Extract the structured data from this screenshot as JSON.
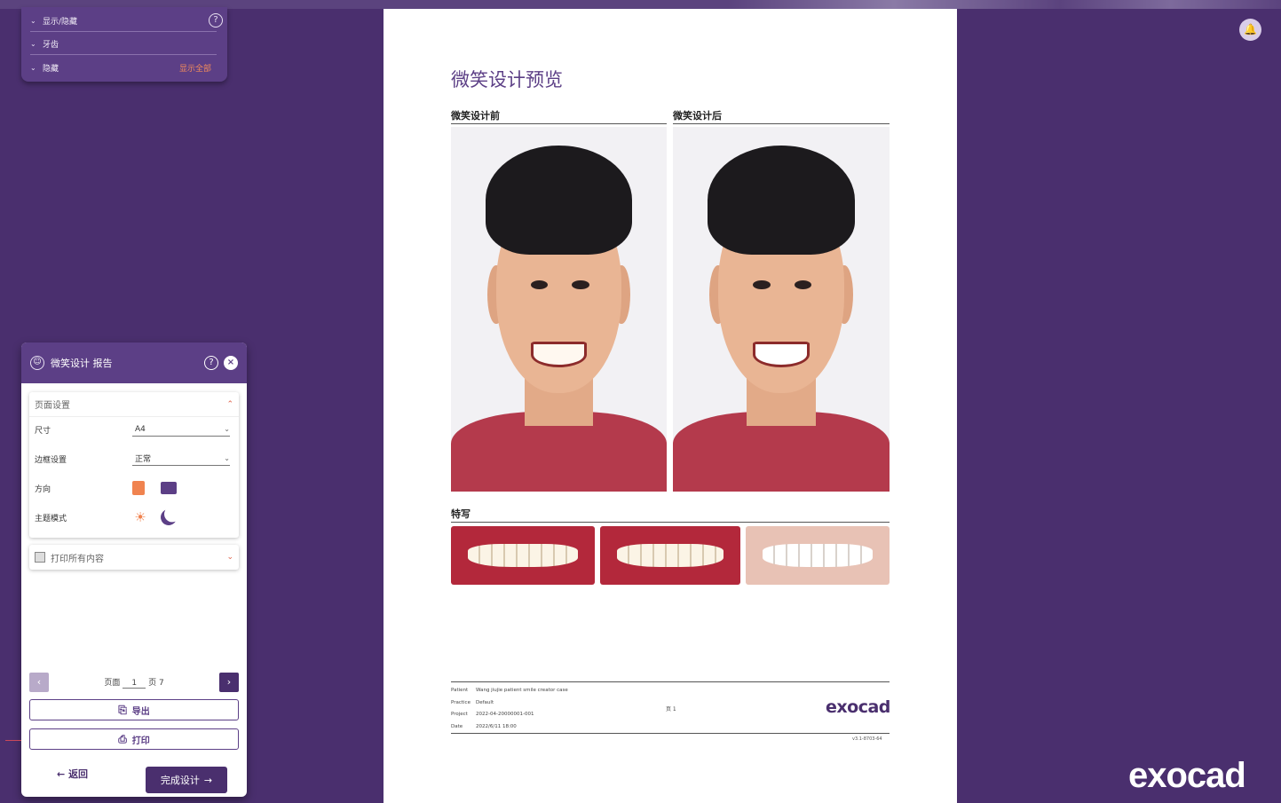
{
  "visibility_panel": {
    "rows": [
      {
        "label": "显示/隐藏",
        "action": ""
      },
      {
        "label": "牙齿",
        "action": ""
      },
      {
        "label": "隐藏",
        "action": "显示全部"
      }
    ],
    "help": "?"
  },
  "report_panel": {
    "title": "微笑设计 报告",
    "page_settings": {
      "header": "页面设置",
      "size_label": "尺寸",
      "size_value": "A4",
      "margin_label": "边框设置",
      "margin_value": "正常",
      "orientation_label": "方向",
      "theme_label": "主题模式"
    },
    "print_all": "打印所有内容",
    "pager": {
      "prefix": "页面",
      "current": "1",
      "suffix": "页 7"
    },
    "export_label": "导出",
    "print_label": "打印",
    "back_label": "返回",
    "finish_label": "完成设计"
  },
  "document": {
    "title": "微笑设计预览",
    "before_label": "微笑设计前",
    "after_label": "微笑设计后",
    "closeup_label": "特写",
    "footer": {
      "patient_key": "Patient",
      "patient_val": "Wang jiujie patient smile creator case",
      "practice_key": "Practice",
      "practice_val": "Default",
      "project_key": "Project",
      "project_val": "2022-04-20000001-001",
      "date_key": "Date",
      "date_val": "2022/6/11 18:00",
      "page": "页 1",
      "logo": "exocad",
      "version": "v3.1-8703-64"
    }
  },
  "brand": {
    "logo": "exocad"
  },
  "colors": {
    "background": "#4a2f6e",
    "panel": "#5c3f86",
    "accent": "#f0834f"
  },
  "icons": [
    "help-icon",
    "close-icon",
    "face-icon",
    "sun-icon",
    "moon-icon",
    "export-icon",
    "print-icon",
    "bell-icon",
    "arrow-left-icon",
    "arrow-right-icon"
  ]
}
